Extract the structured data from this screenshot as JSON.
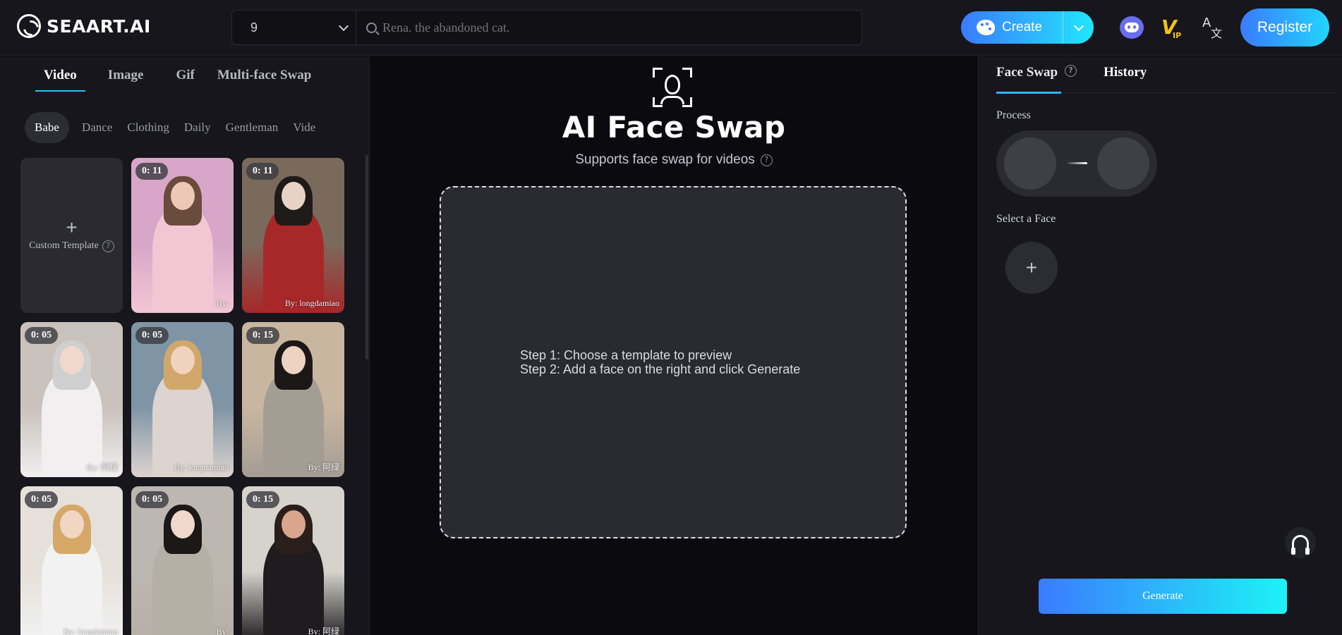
{
  "brand": {
    "logo_text": "SEAART.AI"
  },
  "search": {
    "selected_option": "9",
    "placeholder": "Rena. the abandoned cat."
  },
  "header": {
    "create_label": "Create",
    "register_label": "Register",
    "icons": [
      "palette-icon",
      "discord-icon",
      "vip-icon",
      "translate-icon"
    ],
    "vip_text": "V",
    "vip_sub": "IP"
  },
  "left": {
    "type_tabs": [
      "Video",
      "Image",
      "Gif",
      "Multi-face Swap"
    ],
    "active_type_tab": "Video",
    "categories": [
      "Babe",
      "Dance",
      "Clothing",
      "Daily",
      "Gentleman",
      "Vide"
    ],
    "active_category": "Babe",
    "custom_template_label": "Custom Template",
    "cards": [
      {
        "duration": "0: 11",
        "by": "By: ",
        "palette": [
          "#d7a6c8",
          "#f3c6d4",
          "#6b4b3c",
          "#ecc9b6"
        ]
      },
      {
        "duration": "0: 11",
        "by": "By: longdamiao",
        "palette": [
          "#7a6a5c",
          "#a8282a",
          "#1e1a18",
          "#e8d2c6"
        ]
      },
      {
        "duration": "0: 05",
        "by": "By: 阿绿",
        "palette": [
          "#c9c2bc",
          "#f1efef",
          "#cfcfcf",
          "#f0d8cc"
        ]
      },
      {
        "duration": "0: 05",
        "by": "By: longdamiao",
        "palette": [
          "#7f95a6",
          "#ddd3cf",
          "#d1a86a",
          "#f1d2bf"
        ]
      },
      {
        "duration": "0: 15",
        "by": "By: 阿绿",
        "palette": [
          "#c9b6a0",
          "#a49d94",
          "#1c1817",
          "#edd3c1"
        ]
      },
      {
        "duration": "0: 05",
        "by": "By: longdamiao",
        "palette": [
          "#e6e0da",
          "#f2f2f2",
          "#d5a868",
          "#f2d6c4"
        ]
      },
      {
        "duration": "0: 05",
        "by": "By: ",
        "palette": [
          "#bdb7b1",
          "#b6afa6",
          "#1b1817",
          "#f0d8cc"
        ]
      },
      {
        "duration": "0: 15",
        "by": "By: 阿绿",
        "palette": [
          "#d6d2cc",
          "#1e1c1e",
          "#2a1e1a",
          "#d8a68c"
        ]
      }
    ]
  },
  "center": {
    "title": "AI Face Swap",
    "subtitle": "Supports face swap for videos",
    "step1": "Step 1: Choose a template to preview",
    "step2": "Step 2: Add a face on the right and click Generate"
  },
  "right": {
    "tabs": [
      "Face Swap",
      "History"
    ],
    "active_tab": "Face Swap",
    "process_label": "Process",
    "select_face_label": "Select a Face",
    "generate_label": "Generate"
  },
  "colors": {
    "accent_start": "#3a7bff",
    "accent_end": "#22e6ff",
    "panel": "#16161c",
    "background": "#0b0b0f"
  }
}
